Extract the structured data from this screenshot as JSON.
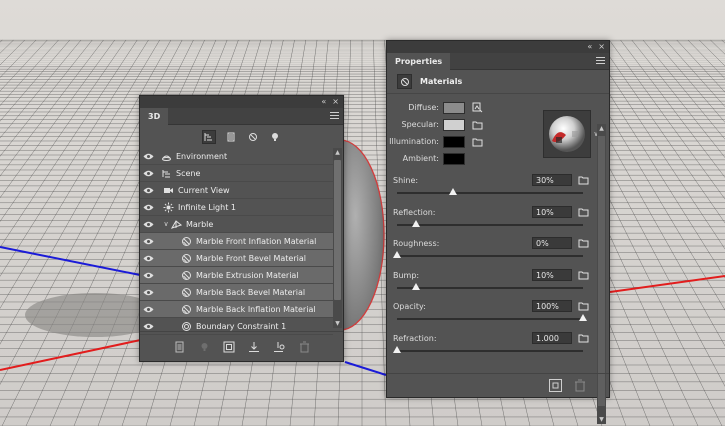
{
  "panel_3d": {
    "tab": "3D",
    "collapse_glyph": "«",
    "close_glyph": "×",
    "filters": [
      "scene-filter-icon",
      "mesh-filter-icon",
      "material-filter-icon",
      "light-filter-icon"
    ],
    "layers": [
      {
        "name": "Environment",
        "icon": "environment-icon",
        "indent": 0,
        "twirl": "",
        "selected": false
      },
      {
        "name": "Scene",
        "icon": "scene-icon",
        "indent": 0,
        "twirl": "",
        "selected": false
      },
      {
        "name": "Current View",
        "icon": "camera-icon",
        "indent": 1,
        "twirl": "",
        "selected": false
      },
      {
        "name": "Infinite Light 1",
        "icon": "light-icon",
        "indent": 1,
        "twirl": "",
        "selected": false
      },
      {
        "name": "Marble",
        "icon": "mesh-icon",
        "indent": 1,
        "twirl": "∨",
        "selected": false
      },
      {
        "name": "Marble Front Inflation Material",
        "icon": "material-icon",
        "indent": 2,
        "twirl": "",
        "selected": true
      },
      {
        "name": "Marble Front Bevel Material",
        "icon": "material-icon",
        "indent": 2,
        "twirl": "",
        "selected": true
      },
      {
        "name": "Marble Extrusion Material",
        "icon": "material-icon",
        "indent": 2,
        "twirl": "",
        "selected": true
      },
      {
        "name": "Marble Back Bevel Material",
        "icon": "material-icon",
        "indent": 2,
        "twirl": "",
        "selected": true
      },
      {
        "name": "Marble Back Inflation Material",
        "icon": "material-icon",
        "indent": 2,
        "twirl": "",
        "selected": true
      },
      {
        "name": "Boundary Constraint 1",
        "icon": "constraint-icon",
        "indent": 2,
        "twirl": "",
        "selected": false
      }
    ],
    "bottom_buttons": [
      "new-mesh-icon",
      "add-light-icon",
      "render-icon",
      "drop-to-ground-icon",
      "add-constraint-icon",
      "delete-icon"
    ]
  },
  "panel_props": {
    "tab": "Properties",
    "collapse_glyph": "«",
    "close_glyph": "×",
    "section_title": "Materials",
    "colors": [
      {
        "label": "Diffuse:",
        "swatch": "#8c8c8c",
        "tex": "texture-edit-icon"
      },
      {
        "label": "Specular:",
        "swatch": "#d0d0d0",
        "tex": "folder-icon"
      },
      {
        "label": "Illumination:",
        "swatch": "#000000",
        "tex": "folder-icon"
      },
      {
        "label": "Ambient:",
        "swatch": "#000000",
        "tex": ""
      }
    ],
    "sliders": [
      {
        "label": "Shine:",
        "value": "30%",
        "fraction": 0.3
      },
      {
        "label": "Reflection:",
        "value": "10%",
        "fraction": 0.1
      },
      {
        "label": "Roughness:",
        "value": "0%",
        "fraction": 0.0
      },
      {
        "label": "Bump:",
        "value": "10%",
        "fraction": 0.1
      },
      {
        "label": "Opacity:",
        "value": "100%",
        "fraction": 1.0
      },
      {
        "label": "Refraction:",
        "value": "1.000",
        "fraction": 0.0
      }
    ]
  }
}
